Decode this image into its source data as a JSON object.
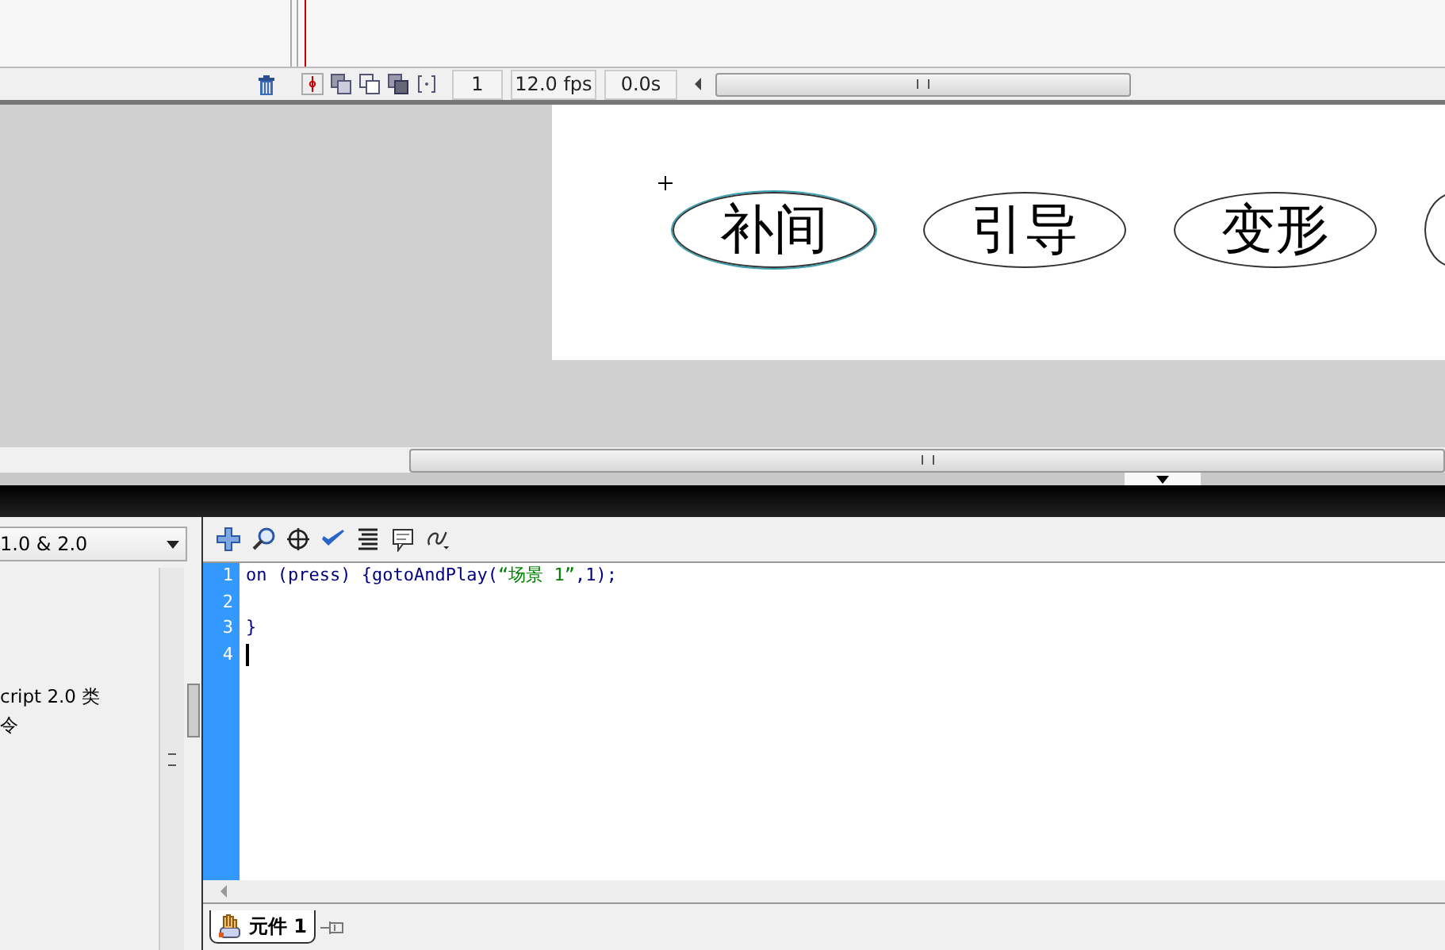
{
  "timeline": {
    "frame": "1",
    "frame_rate": "12.0 fps",
    "elapsed": "0.0s"
  },
  "stage": {
    "buttons": [
      {
        "label": "补间",
        "selected": true
      },
      {
        "label": "引导",
        "selected": false
      },
      {
        "label": "变形",
        "selected": false
      }
    ]
  },
  "actions_panel": {
    "version_dropdown": "1.0 & 2.0",
    "toolbox_items": [
      "cript 2.0 类",
      "令"
    ],
    "code_lines": [
      {
        "number": "1",
        "cursor": false,
        "segments": [
          {
            "kind": "plain",
            "text": "on (press) {gotoAndPlay("
          },
          {
            "kind": "string",
            "text": "“场景 1”"
          },
          {
            "kind": "plain",
            "text": ",1);"
          }
        ]
      },
      {
        "number": "2",
        "cursor": false
      },
      {
        "number": "3",
        "cursor": false,
        "segments": [
          {
            "kind": "plain",
            "text": "}"
          }
        ]
      },
      {
        "number": "4",
        "cursor": true
      }
    ],
    "tab": "元件 1"
  }
}
